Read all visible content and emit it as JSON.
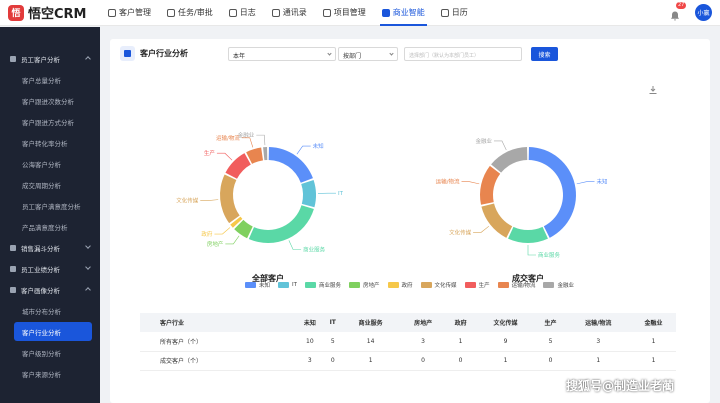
{
  "app": {
    "logo_mark": "悟",
    "logo_text": "悟空CRM"
  },
  "nav": [
    {
      "label": "客户管理",
      "icon": "customer-icon"
    },
    {
      "label": "任务/审批",
      "icon": "task-icon"
    },
    {
      "label": "日志",
      "icon": "log-icon"
    },
    {
      "label": "通讯录",
      "icon": "contacts-icon"
    },
    {
      "label": "项目管理",
      "icon": "project-icon"
    },
    {
      "label": "商业智能",
      "icon": "bi-icon",
      "active": true
    },
    {
      "label": "日历",
      "icon": "calendar-icon"
    }
  ],
  "topright": {
    "badge": "27",
    "avatar": "小赢"
  },
  "sidebar": {
    "g1": "员工客户分析",
    "g1_items": [
      "客户总量分析",
      "客户跟进次数分析",
      "客户跟进方式分析",
      "客户转化率分析",
      "公海客户分析",
      "成交周期分析",
      "员工客户满意度分析",
      "产品满意度分析"
    ],
    "g2": "销售漏斗分析",
    "g3": "员工业绩分析",
    "g4": "客户画像分析",
    "g4_items": [
      "城市分布分析",
      "客户行业分析",
      "客户级别分析",
      "客户来源分析"
    ],
    "active": "客户行业分析"
  },
  "page": {
    "title": "客户行业分析",
    "period": "本年",
    "dept": "按部门",
    "search_placeholder": "选择部门（默认为本部门员工）",
    "search_btn": "搜索"
  },
  "colors": {
    "accent": "#1a56db"
  },
  "chart_data": {
    "type": "pie",
    "categories": [
      "未知",
      "IT",
      "商业服务",
      "房地产",
      "政府",
      "文化传媒",
      "生产",
      "运输/物流",
      "金融业"
    ],
    "colors": [
      "#5b8ff9",
      "#61c3d8",
      "#5ad8a6",
      "#7fd05f",
      "#f6c84a",
      "#d8a65c",
      "#f15d5d",
      "#e8854f",
      "#a8a8a8"
    ],
    "series": [
      {
        "name": "全部客户",
        "values": [
          10,
          5,
          14,
          3,
          1,
          9,
          5,
          3,
          1
        ]
      },
      {
        "name": "成交客户",
        "values": [
          3,
          0,
          1,
          0,
          0,
          1,
          0,
          1,
          1
        ]
      }
    ]
  },
  "table": {
    "headers": [
      "客户行业",
      "未知",
      "IT",
      "商业服务",
      "房地产",
      "政府",
      "文化传媒",
      "生产",
      "运输/物流",
      "金融业"
    ],
    "rows": [
      [
        "所有客户（个）",
        "10",
        "5",
        "14",
        "3",
        "1",
        "9",
        "5",
        "3",
        "1"
      ],
      [
        "成交客户（个）",
        "3",
        "0",
        "1",
        "0",
        "0",
        "1",
        "0",
        "1",
        "1"
      ]
    ]
  },
  "watermark": "搜狐号@制造业老蔺"
}
